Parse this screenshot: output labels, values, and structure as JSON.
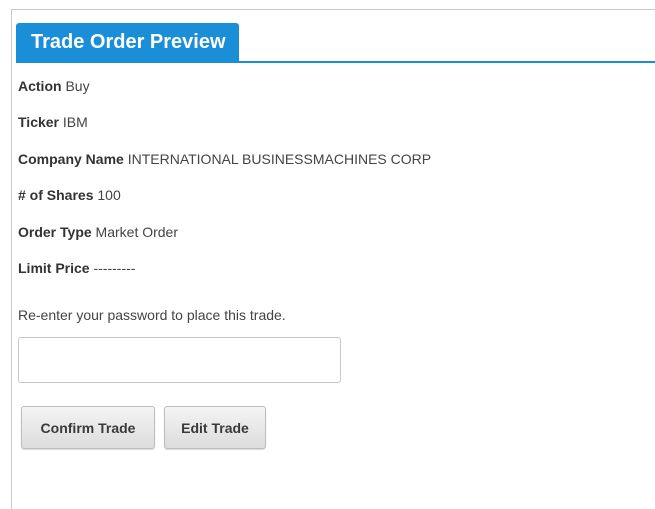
{
  "panel": {
    "title": "Trade Order Preview",
    "accent_color": "#1a8fd8"
  },
  "details": [
    {
      "label": "Action",
      "value": "Buy"
    },
    {
      "label": "Ticker",
      "value": "IBM"
    },
    {
      "label": "Company Name",
      "value": "INTERNATIONAL BUSINESSMACHINES CORP"
    },
    {
      "label": "# of Shares",
      "value": "100"
    },
    {
      "label": "Order Type",
      "value": "Market Order"
    },
    {
      "label": "Limit Price",
      "value": "---------"
    }
  ],
  "password": {
    "prompt": "Re-enter your password to place this trade.",
    "value": "",
    "placeholder": ""
  },
  "buttons": {
    "confirm_label": "Confirm Trade",
    "edit_label": "Edit Trade"
  }
}
